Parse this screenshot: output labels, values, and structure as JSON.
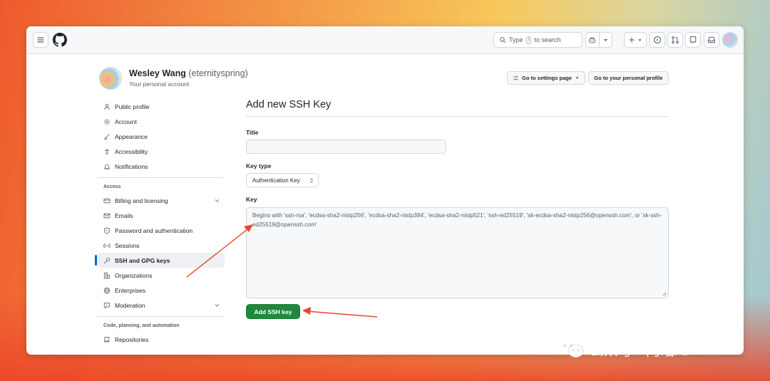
{
  "header": {
    "search_label": "Type",
    "search_kbd": "/",
    "search_suffix": "to search"
  },
  "user": {
    "name": "Wesley Wang",
    "login": "(eternityspring)",
    "subtitle": "Your personal account"
  },
  "actions": {
    "settings_label": "Go to settings page",
    "profile_label": "Go to your personal profile"
  },
  "sidebar": {
    "items": [
      {
        "label": "Public profile"
      },
      {
        "label": "Account"
      },
      {
        "label": "Appearance"
      },
      {
        "label": "Accessibility"
      },
      {
        "label": "Notifications"
      }
    ],
    "access_heading": "Access",
    "access_items": [
      {
        "label": "Billing and licensing"
      },
      {
        "label": "Emails"
      },
      {
        "label": "Password and authentication"
      },
      {
        "label": "Sessions"
      },
      {
        "label": "SSH and GPG keys"
      },
      {
        "label": "Organizations"
      },
      {
        "label": "Enterprises"
      },
      {
        "label": "Moderation"
      }
    ],
    "code_heading": "Code, planning, and automation",
    "code_items": [
      {
        "label": "Repositories"
      }
    ]
  },
  "form": {
    "title": "Add new SSH Key",
    "title_label": "Title",
    "title_value": "",
    "keytype_label": "Key type",
    "keytype_selected": "Authentication Key",
    "key_label": "Key",
    "key_placeholder": "Begins with 'ssh-rsa', 'ecdsa-sha2-nistp256', 'ecdsa-sha2-nistp384', 'ecdsa-sha2-nistp521', 'ssh-ed25519', 'sk-ecdsa-sha2-nistp256@openssh.com', or 'sk-ssh-ed25519@openssh.com'",
    "submit_label": "Add SSH key"
  },
  "watermark": {
    "text": "公众号 · 阿皓AI"
  },
  "colors": {
    "accent_green": "#1f883d",
    "active_indicator": "#0969da",
    "annotation_arrow": "#e8462a"
  }
}
